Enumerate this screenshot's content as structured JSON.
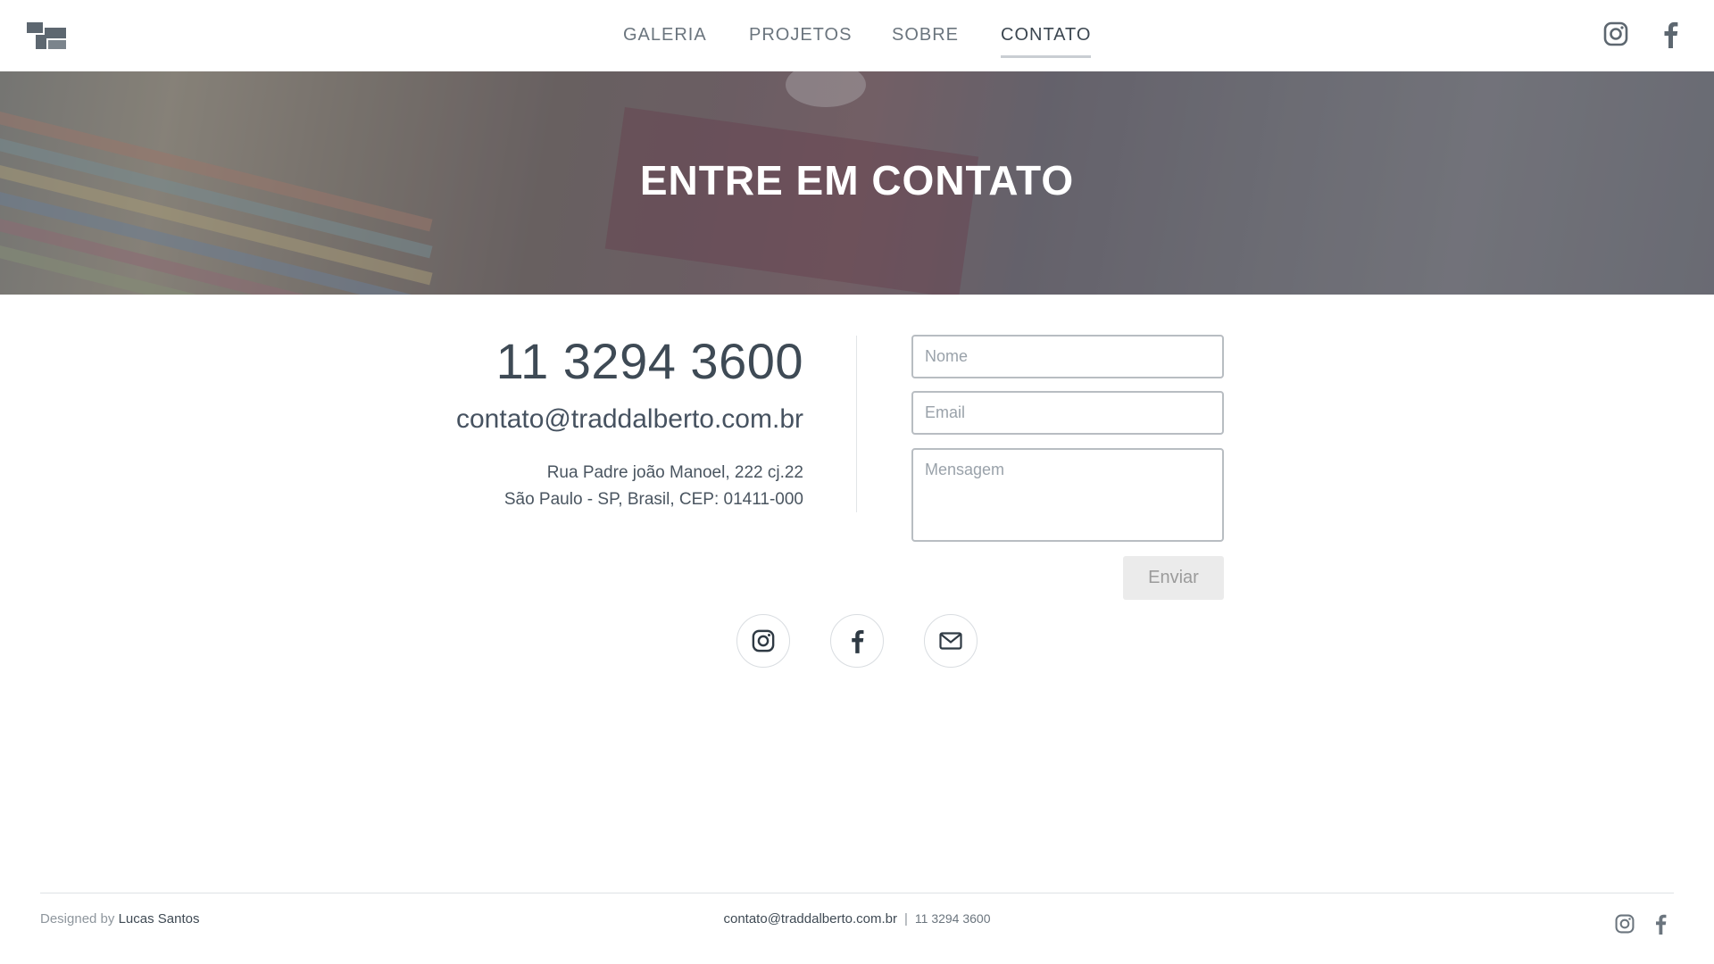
{
  "header": {
    "nav": [
      {
        "label": "GALERIA"
      },
      {
        "label": "PROJETOS"
      },
      {
        "label": "SOBRE"
      },
      {
        "label": "CONTATO",
        "active": true
      }
    ],
    "icons": [
      "logo-icon",
      "instagram-icon",
      "facebook-icon"
    ]
  },
  "hero": {
    "title": "ENTRE EM CONTATO"
  },
  "contact": {
    "phone": "11 3294 3600",
    "email": "contato@traddalberto.com.br",
    "address_line1": "Rua Padre joão Manoel, 222 cj.22",
    "address_line2": "São Paulo - SP, Brasil, CEP: 01411-000"
  },
  "form": {
    "name_placeholder": "Nome",
    "email_placeholder": "Email",
    "message_placeholder": "Mensagem",
    "send_label": "Enviar"
  },
  "social_buttons": [
    "instagram-icon",
    "facebook-icon",
    "mail-icon"
  ],
  "footer": {
    "designed_by": "Designed by",
    "author": "Lucas Santos",
    "email": "contato@traddalberto.com.br",
    "separator": "|",
    "phone": "11 3294 3600"
  },
  "colors": {
    "text": "#3e4a55",
    "nav": "#6b757e",
    "button_bg": "#ebebeb",
    "border": "#b8bdc2"
  }
}
